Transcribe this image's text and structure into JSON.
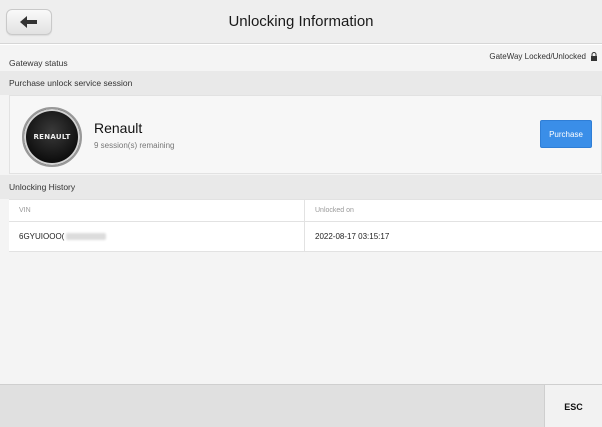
{
  "header": {
    "title": "Unlocking Information",
    "back_icon": "arrow-left-icon"
  },
  "gateway": {
    "label": "Gateway status",
    "status_text": "GateWay Locked/Unlocked",
    "status_icon": "lock-icon"
  },
  "purchase_section": {
    "label": "Purchase unlock service session"
  },
  "brand": {
    "logo_text": "RENAULT",
    "name": "Renault",
    "sessions_remaining": "9 session(s) remaining",
    "purchase_label": "Purchase"
  },
  "history": {
    "label": "Unlocking History",
    "columns": [
      "VIN",
      "Unlocked on"
    ],
    "rows": [
      {
        "vin": "6GYUIOOO(",
        "unlocked_on": "2022-08-17 03:15:17"
      }
    ]
  },
  "footer": {
    "esc_label": "ESC"
  },
  "colors": {
    "accent": "#3a8ee8",
    "header_bg": "#eeeeee"
  }
}
